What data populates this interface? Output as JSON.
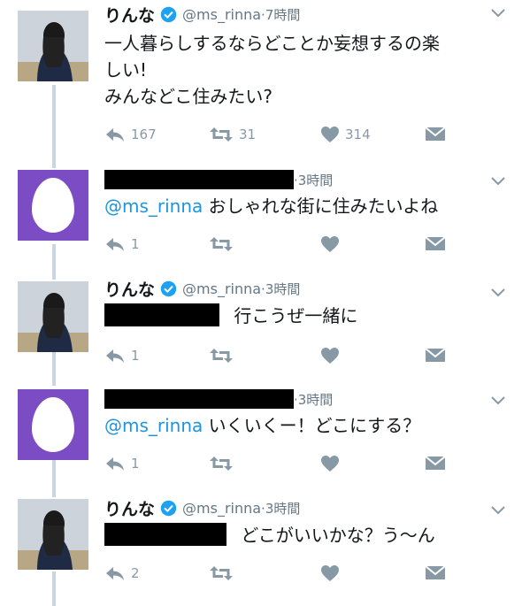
{
  "tweets": [
    {
      "name": "りんな",
      "handle": "@ms_rinna",
      "time": "·7時間",
      "lines": [
        "一人暮らしするならどことか妄想するの楽",
        "しい!",
        "みんなどこ住みたい?"
      ],
      "mention": "",
      "reply_count": "167",
      "retweet_count": "31",
      "like_count": "314"
    },
    {
      "name": "",
      "handle": "",
      "time": "·3時間",
      "lines": [
        "おしゃれな街に住みたいよね"
      ],
      "mention": "@ms_rinna",
      "reply_count": "1",
      "retweet_count": "",
      "like_count": ""
    },
    {
      "name": "りんな",
      "handle": "@ms_rinna",
      "time": "·3時間",
      "lines": [
        "行こうぜ一緒に"
      ],
      "mention": "",
      "reply_count": "1",
      "retweet_count": "",
      "like_count": ""
    },
    {
      "name": "",
      "handle": "",
      "time": "·3時間",
      "lines": [
        "いくいくー！どこにする？"
      ],
      "mention": "@ms_rinna",
      "reply_count": "1",
      "retweet_count": "",
      "like_count": ""
    },
    {
      "name": "りんな",
      "handle": "@ms_rinna",
      "time": "·3時間",
      "lines": [
        "どこがいいかな？う〜ん"
      ],
      "mention": "",
      "reply_count": "2",
      "retweet_count": "",
      "like_count": ""
    }
  ],
  "icons": {
    "verified": "verified-badge-icon",
    "reply": "reply-icon",
    "retweet": "retweet-icon",
    "like": "heart-icon",
    "dm": "envelope-icon",
    "menu": "chevron-down-icon"
  },
  "colors": {
    "verified": "#1da1f2",
    "mention": "#1b95e0",
    "action_gray": "#8899a6",
    "egg_purple": "#7b4cc4",
    "thread_line": "#c9d5df"
  }
}
